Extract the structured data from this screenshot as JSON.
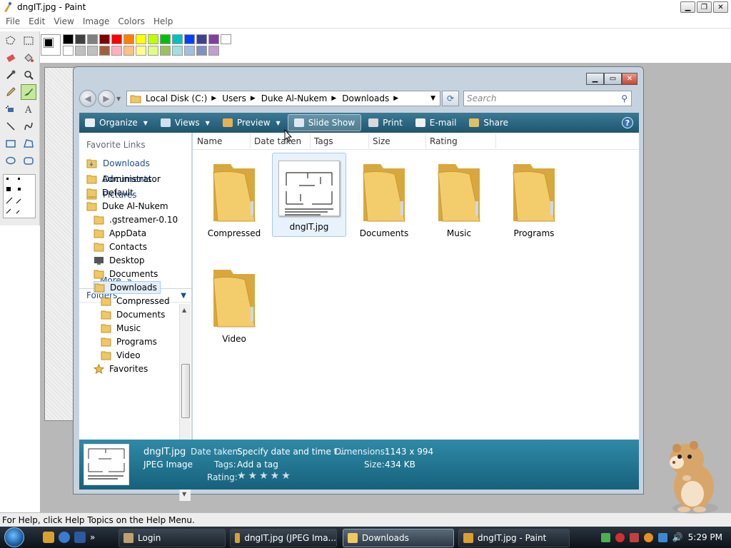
{
  "paint": {
    "title": "dngIT.jpg - Paint",
    "menu": [
      "File",
      "Edit",
      "View",
      "Image",
      "Colors",
      "Help"
    ],
    "status": "For Help, click Help Topics on the Help Menu.",
    "palette_colors": [
      "#000000",
      "#404040",
      "#808080",
      "#800000",
      "#ff0000",
      "#ff8000",
      "#ffff00",
      "#c0ff00",
      "#00c000",
      "#00c0c0",
      "#0040ff",
      "#404090",
      "#8040a0",
      "#ffffff",
      "#ffffff",
      "#c0c0c0",
      "#c0c0c0",
      "#a06040",
      "#ffb0c0",
      "#ffc080",
      "#ffff90",
      "#e0ff80",
      "#a0c060",
      "#a0e0e0",
      "#a0c0e0",
      "#8090c0",
      "#c0a0d0"
    ]
  },
  "explorer": {
    "breadcrumb": [
      "Local Disk (C:)",
      "Users",
      "Duke Al-Nukem",
      "Downloads"
    ],
    "search_placeholder": "Search",
    "commands": {
      "organize": "Organize",
      "views": "Views",
      "preview": "Preview",
      "slideshow": "Slide Show",
      "print": "Print",
      "email": "E-mail",
      "share": "Share"
    },
    "favorite_links_title": "Favorite Links",
    "favorites": [
      "Downloads",
      "Documents",
      "Pictures"
    ],
    "more": "More",
    "folders_title": "Folders",
    "tree": [
      "Administrator",
      "Default",
      "Duke Al-Nukem",
      ".gstreamer-0.10",
      "AppData",
      "Contacts",
      "Desktop",
      "Documents",
      "Downloads",
      "Compressed",
      "Documents",
      "Music",
      "Programs",
      "Video",
      "Favorites"
    ],
    "columns": [
      "Name",
      "Date taken",
      "Tags",
      "Size",
      "Rating"
    ],
    "files": [
      "Compressed",
      "dngIT.jpg",
      "Documents",
      "Music",
      "Programs",
      "Video"
    ],
    "details": {
      "filename": "dngIT.jpg",
      "filetype": "JPEG Image",
      "date_label": "Date taken:",
      "date_value": "Specify date and time t...",
      "tags_label": "Tags:",
      "tags_value": "Add a tag",
      "rating_label": "Rating:",
      "rating_stars": "★★★★★",
      "dimensions_label": "Dimensions:",
      "dimensions_value": "1143 x 994",
      "size_label": "Size:",
      "size_value": "434 KB"
    }
  },
  "taskbar": {
    "tasks": [
      "Login",
      "dngIT.jpg (JPEG Ima...",
      "Downloads",
      "dngIT.jpg - Paint"
    ],
    "clock": "5:29 PM",
    "quicklaunch_more": "»"
  },
  "colors": {
    "folder": "#f0c860",
    "folder_dark": "#d8a83c",
    "accent": "#1e4e8c"
  }
}
